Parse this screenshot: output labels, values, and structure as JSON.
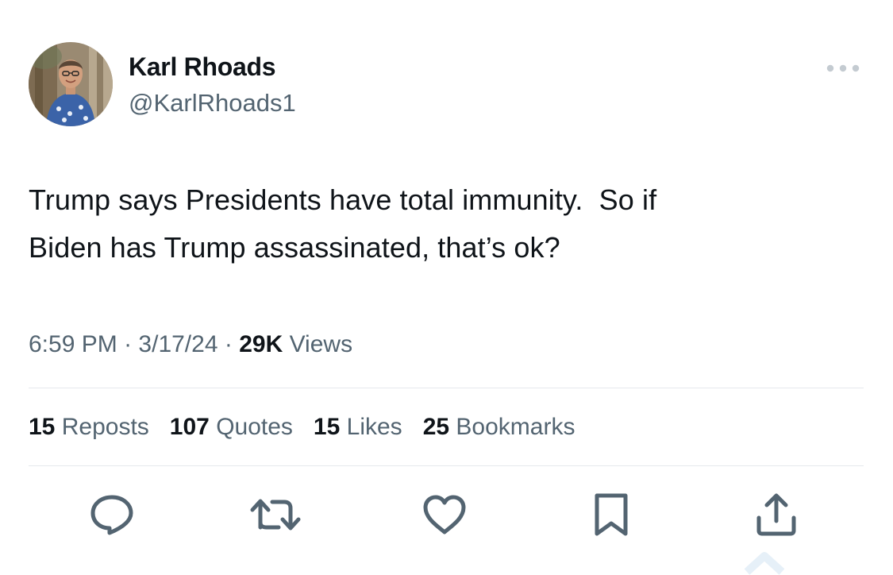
{
  "author": {
    "display_name": "Karl Rhoads",
    "handle": "@KarlRhoads1"
  },
  "more_icon": "more-horizontal-icon",
  "tweet": {
    "text": "Trump says Presidents have total immunity.  So if\nBiden has Trump assassinated, that’s ok?",
    "time": "6:59 PM",
    "date": "3/17/24",
    "separator": "·",
    "views_count": "29K",
    "views_label": "Views"
  },
  "stats": {
    "reposts": {
      "count": "15",
      "label": "Reposts"
    },
    "quotes": {
      "count": "107",
      "label": "Quotes"
    },
    "likes": {
      "count": "15",
      "label": "Likes"
    },
    "bookmarks": {
      "count": "25",
      "label": "Bookmarks"
    }
  },
  "actions": [
    {
      "icon": "reply-icon"
    },
    {
      "icon": "repost-icon"
    },
    {
      "icon": "like-icon"
    },
    {
      "icon": "bookmark-icon"
    },
    {
      "icon": "share-icon"
    }
  ],
  "colors": {
    "text_primary": "#0f1419",
    "text_secondary": "#536471",
    "divider": "#e6e9ec",
    "icon": "#536471",
    "background": "#ffffff"
  }
}
